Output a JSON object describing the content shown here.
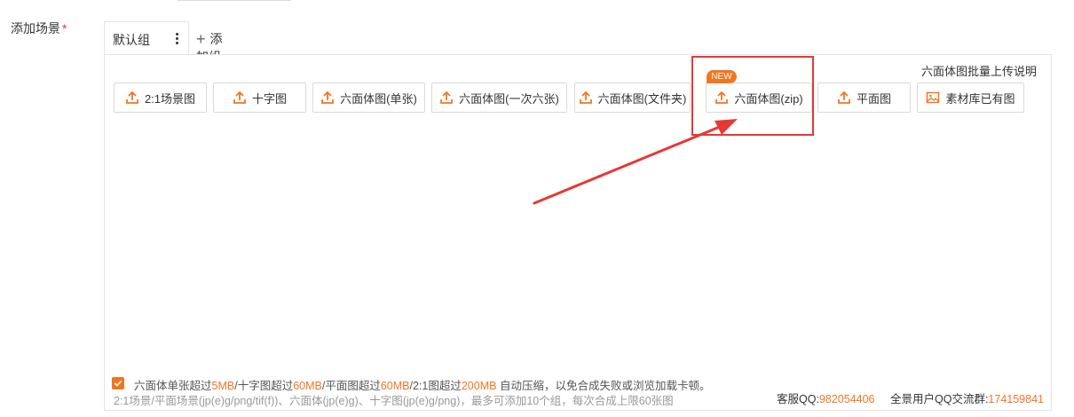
{
  "form": {
    "label": "添加场景",
    "required_mark": "*"
  },
  "tabs": {
    "active": "默认组",
    "add_group": "添加组",
    "add_icon": "+"
  },
  "panel": {
    "batch_upload_help": "六面体图批量上传说明",
    "new_badge": "NEW",
    "buttons": [
      {
        "label": "2:1场景图",
        "icon": "upload-icon"
      },
      {
        "label": "十字图",
        "icon": "upload-icon"
      },
      {
        "label": "六面体图(单张)",
        "icon": "upload-icon"
      },
      {
        "label": "六面体图(一次六张)",
        "icon": "upload-icon"
      },
      {
        "label": "六面体图(文件夹)",
        "icon": "upload-icon"
      },
      {
        "label": "六面体图(zip)",
        "icon": "upload-icon"
      },
      {
        "label": "平面图",
        "icon": "upload-icon"
      },
      {
        "label": "素材库已有图",
        "icon": "image-icon"
      }
    ],
    "compress_note": {
      "p1": "六面体单张超过",
      "v1": "5MB",
      "p2": "/十字图超过",
      "v2": "60MB",
      "p3": "/平面图超过",
      "v3": "60MB",
      "p4": "/2:1图超过",
      "v4": "200MB",
      "p5": " 自动压缩，以免合成失败或浏览加载卡顿。"
    },
    "format_note": "2:1场景/平面场景(jp(e)g/png/tif(f))、六面体(jp(e)g)、十字图(jp(e)g/png)，最多可添加10个组，每次合成上限60张图",
    "contact": {
      "service_label": "客服QQ:",
      "service_value": "982054406",
      "group_label": "全景用户QQ交流群:",
      "group_value": "174159841"
    }
  },
  "colors": {
    "accent": "#f07622",
    "annotation": "#e53935"
  }
}
